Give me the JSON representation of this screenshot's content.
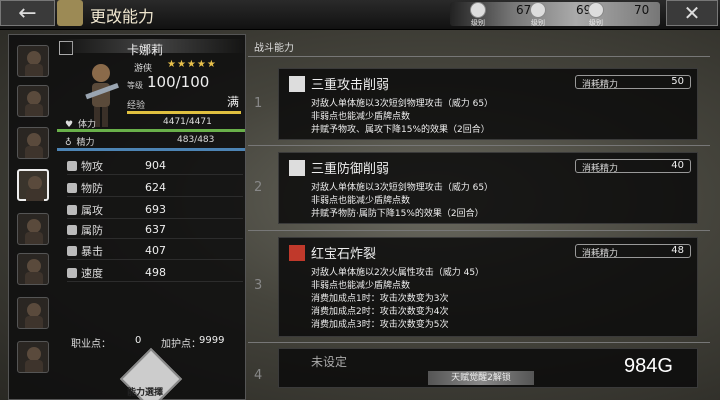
{
  "header": {
    "title": "更改能力",
    "back_icon": "←",
    "close_icon": "✕"
  },
  "resources": [
    {
      "label": "级别",
      "value": "67"
    },
    {
      "label": "级别",
      "value": "69"
    },
    {
      "label": "级别",
      "value": "70"
    }
  ],
  "character": {
    "name": "卡娜莉",
    "class": "游侠",
    "stars": "★★★★★",
    "level_label": "等级",
    "level": "100/100",
    "exp_label": "经验",
    "exp_status": "满",
    "hp_label": "体力",
    "hp": "4471/4471",
    "mp_label": "精力",
    "mp": "483/483",
    "stats": [
      {
        "label": "物攻",
        "value": "904"
      },
      {
        "label": "物防",
        "value": "624"
      },
      {
        "label": "属攻",
        "value": "693"
      },
      {
        "label": "属防",
        "value": "637"
      },
      {
        "label": "暴击",
        "value": "407"
      },
      {
        "label": "速度",
        "value": "498"
      }
    ],
    "job_points_label": "职业点：",
    "job_points": "0",
    "bonus_points_label": "加护点：",
    "bonus_points": "9999",
    "ability_button_label": "能力選擇"
  },
  "section_title": "战斗能力",
  "skills": [
    {
      "slot": "1",
      "name": "三重攻击削弱",
      "icon": "sword-icon",
      "cost_label": "消耗精力",
      "cost": "50",
      "lines": [
        "对敌人单体施以3次短剑物理攻击（威力 65）",
        "非弱点也能减少盾牌点数",
        "并赋予物攻、属攻下降15%的效果（2回合）"
      ]
    },
    {
      "slot": "2",
      "name": "三重防御削弱",
      "icon": "sword-icon",
      "cost_label": "消耗精力",
      "cost": "40",
      "lines": [
        "对敌人单体施以3次短剑物理攻击（威力 65）",
        "非弱点也能减少盾牌点数",
        "并赋予物防·属防下降15%的效果（2回合）"
      ]
    },
    {
      "slot": "3",
      "name": "红宝石炸裂",
      "icon": "fire-icon",
      "cost_label": "消耗精力",
      "cost": "48",
      "lines": [
        "对敌人单体施以2次火属性攻击（威力 45）",
        "非弱点也能减少盾牌点数",
        "消费加成点1时：攻击次数变为3次",
        "消费加成点2时：攻击次数变为4次",
        "消费加成点3时：攻击次数变为5次"
      ]
    },
    {
      "slot": "4",
      "name": "未设定"
    }
  ],
  "awaken_label": "天赋觉醒2解锁",
  "watermark": "984G"
}
